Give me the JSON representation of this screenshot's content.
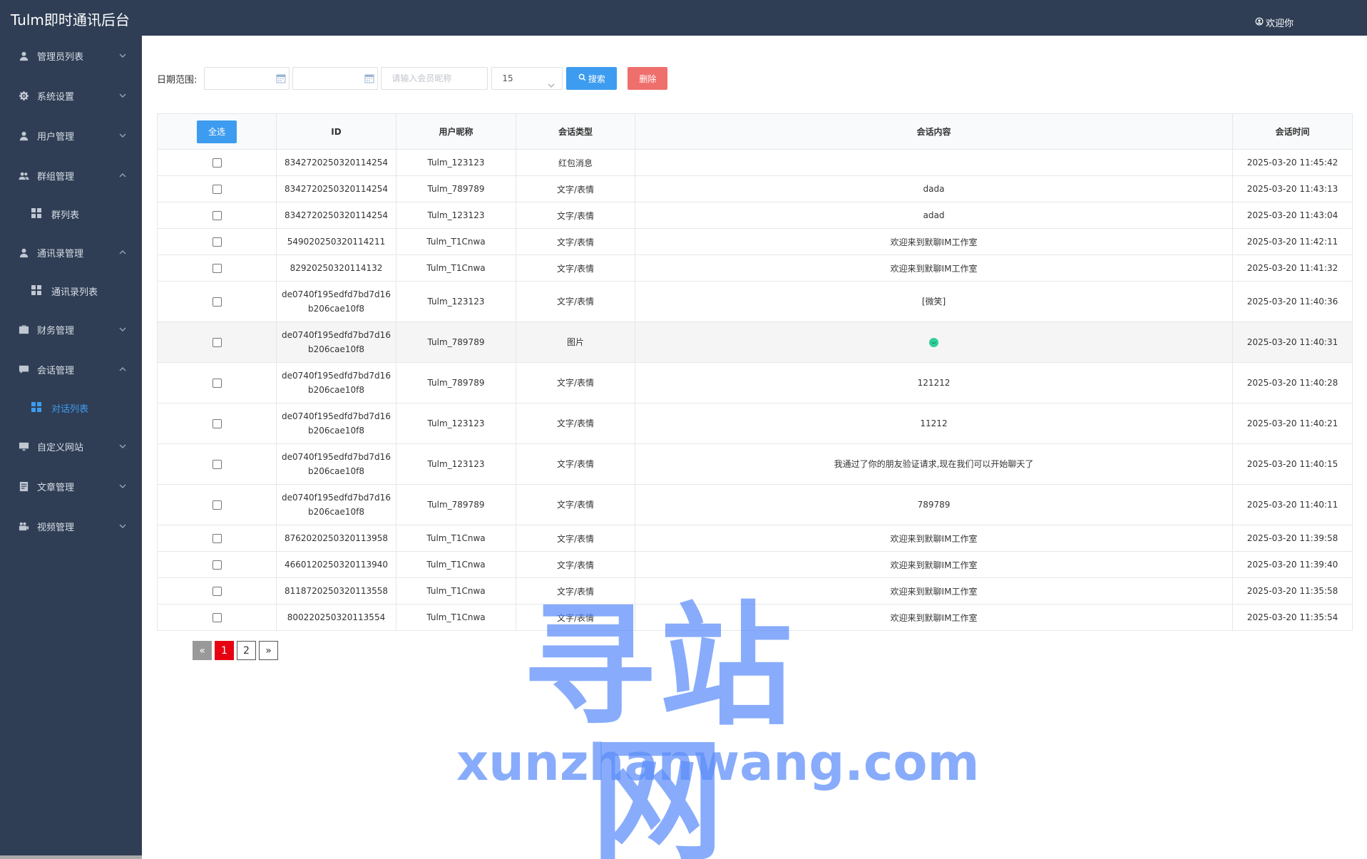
{
  "app": {
    "title": "Tulm即时通讯后台",
    "welcome": "欢迎你"
  },
  "sidebar": {
    "items": [
      {
        "label": "管理员列表",
        "icon": "user-icon",
        "expanded": false
      },
      {
        "label": "系统设置",
        "icon": "gear-icon",
        "expanded": false
      },
      {
        "label": "用户管理",
        "icon": "user-icon",
        "expanded": false
      },
      {
        "label": "群组管理",
        "icon": "users-icon",
        "expanded": true,
        "children": [
          {
            "label": "群列表",
            "icon": "grid-icon",
            "active": false
          }
        ]
      },
      {
        "label": "通讯录管理",
        "icon": "user-icon",
        "expanded": true,
        "children": [
          {
            "label": "通讯录列表",
            "icon": "grid-icon",
            "active": false
          }
        ]
      },
      {
        "label": "财务管理",
        "icon": "briefcase-icon",
        "expanded": false
      },
      {
        "label": "会话管理",
        "icon": "chat-icon",
        "expanded": true,
        "children": [
          {
            "label": "对话列表",
            "icon": "grid-icon",
            "active": true
          }
        ]
      },
      {
        "label": "自定义网站",
        "icon": "monitor-icon",
        "expanded": false
      },
      {
        "label": "文章管理",
        "icon": "document-icon",
        "expanded": false
      },
      {
        "label": "视频管理",
        "icon": "camera-icon",
        "expanded": false
      }
    ]
  },
  "filter": {
    "date_label": "日期范围:",
    "member_placeholder": "请输入会员昵称",
    "page_size": "15",
    "search_label": "搜索",
    "delete_label": "删除"
  },
  "table": {
    "select_all_label": "全选",
    "headers": {
      "id": "ID",
      "nickname": "用户昵称",
      "type": "会话类型",
      "content": "会话内容",
      "time": "会话时间"
    },
    "rows": [
      {
        "id": "8342720250320114254",
        "nickname": "Tulm_123123",
        "type": "红包消息",
        "content": "",
        "time": "2025-03-20 11:45:42"
      },
      {
        "id": "8342720250320114254",
        "nickname": "Tulm_789789",
        "type": "文字/表情",
        "content": "dada",
        "time": "2025-03-20 11:43:13"
      },
      {
        "id": "8342720250320114254",
        "nickname": "Tulm_123123",
        "type": "文字/表情",
        "content": "adad",
        "time": "2025-03-20 11:43:04"
      },
      {
        "id": "549020250320114211",
        "nickname": "Tulm_T1Cnwa",
        "type": "文字/表情",
        "content": "欢迎来到默聊IM工作室",
        "time": "2025-03-20 11:42:11"
      },
      {
        "id": "82920250320114132",
        "nickname": "Tulm_T1Cnwa",
        "type": "文字/表情",
        "content": "欢迎来到默聊IM工作室",
        "time": "2025-03-20 11:41:32"
      },
      {
        "id": "de0740f195edfd7bd7d16 b206cae10f8",
        "nickname": "Tulm_123123",
        "type": "文字/表情",
        "content": "[微笑]",
        "time": "2025-03-20 11:40:36"
      },
      {
        "id": "de0740f195edfd7bd7d16 b206cae10f8",
        "nickname": "Tulm_789789",
        "type": "图片",
        "content": "",
        "time": "2025-03-20 11:40:31"
      },
      {
        "id": "de0740f195edfd7bd7d16 b206cae10f8",
        "nickname": "Tulm_789789",
        "type": "文字/表情",
        "content": "121212",
        "time": "2025-03-20 11:40:28"
      },
      {
        "id": "de0740f195edfd7bd7d16 b206cae10f8",
        "nickname": "Tulm_123123",
        "type": "文字/表情",
        "content": "11212",
        "time": "2025-03-20 11:40:21"
      },
      {
        "id": "de0740f195edfd7bd7d16 b206cae10f8",
        "nickname": "Tulm_123123",
        "type": "文字/表情",
        "content": "我通过了你的朋友验证请求,现在我们可以开始聊天了",
        "time": "2025-03-20 11:40:15"
      },
      {
        "id": "de0740f195edfd7bd7d16 b206cae10f8",
        "nickname": "Tulm_789789",
        "type": "文字/表情",
        "content": "789789",
        "time": "2025-03-20 11:40:11"
      },
      {
        "id": "8762020250320113958",
        "nickname": "Tulm_T1Cnwa",
        "type": "文字/表情",
        "content": "欢迎来到默聊IM工作室",
        "time": "2025-03-20 11:39:58"
      },
      {
        "id": "4660120250320113940",
        "nickname": "Tulm_T1Cnwa",
        "type": "文字/表情",
        "content": "欢迎来到默聊IM工作室",
        "time": "2025-03-20 11:39:40"
      },
      {
        "id": "8118720250320113558",
        "nickname": "Tulm_T1Cnwa",
        "type": "文字/表情",
        "content": "欢迎来到默聊IM工作室",
        "time": "2025-03-20 11:35:58"
      },
      {
        "id": "800220250320113554",
        "nickname": "Tulm_T1Cnwa",
        "type": "文字/表情",
        "content": "欢迎来到默聊IM工作室",
        "time": "2025-03-20 11:35:54"
      }
    ]
  },
  "pagination": {
    "prev": "«",
    "pages": [
      "1",
      "2"
    ],
    "current": "1",
    "next": "»"
  },
  "watermark": {
    "cn": "寻站网",
    "en": "xunzhanwang.com"
  },
  "colors": {
    "sidebar": "#2f3e55",
    "primary": "#3d9cf0",
    "danger": "#ef6f6c",
    "active_page": "#e60012"
  }
}
